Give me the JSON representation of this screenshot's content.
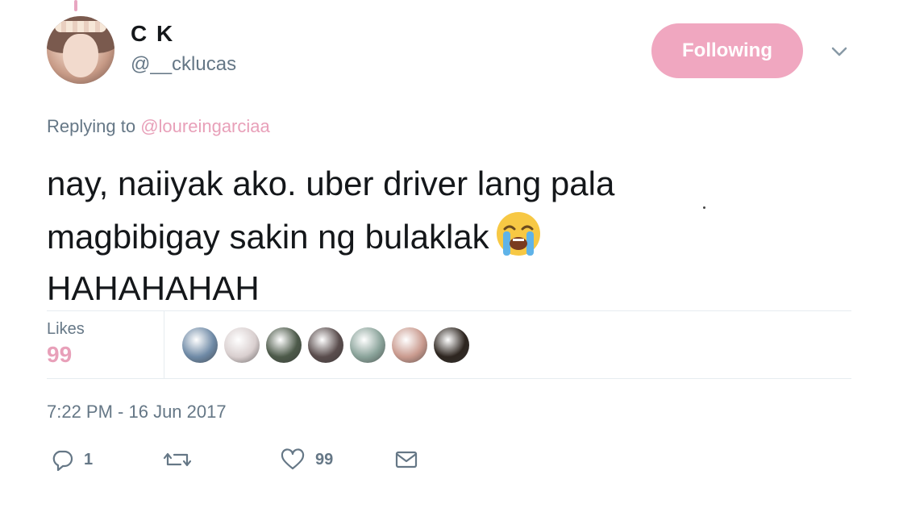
{
  "user": {
    "display_name": "C K",
    "handle": "@__cklucas"
  },
  "follow_button": {
    "label": "Following"
  },
  "reply": {
    "prefix": "Replying to",
    "mention": "@loureingarciaa"
  },
  "tweet": {
    "lines": [
      "nay, naiiyak ako. uber driver lang pala",
      "magbibigay sakin ng bulaklak",
      "HAHAHAHAH"
    ],
    "emoji": "loudly-crying-face-icon"
  },
  "stats": {
    "likes_label": "Likes",
    "likes_count": "99"
  },
  "likers": [
    {
      "name": "liker-avatar-1",
      "color": "#6f8aa6"
    },
    {
      "name": "liker-avatar-2",
      "color": "#d9cfcf"
    },
    {
      "name": "liker-avatar-3",
      "color": "#4d5a4a"
    },
    {
      "name": "liker-avatar-4",
      "color": "#5a4d4d"
    },
    {
      "name": "liker-avatar-5",
      "color": "#8aa39a"
    },
    {
      "name": "liker-avatar-6",
      "color": "#c99a8e"
    },
    {
      "name": "liker-avatar-7",
      "color": "#2e2620"
    }
  ],
  "timestamp": "7:22 PM - 16 Jun 2017",
  "actions": {
    "reply_count": "1",
    "retweet_count": "",
    "like_count": "99"
  },
  "colors": {
    "accent": "#e8a0b9",
    "button": "#f0a7c0",
    "muted": "#657786"
  }
}
